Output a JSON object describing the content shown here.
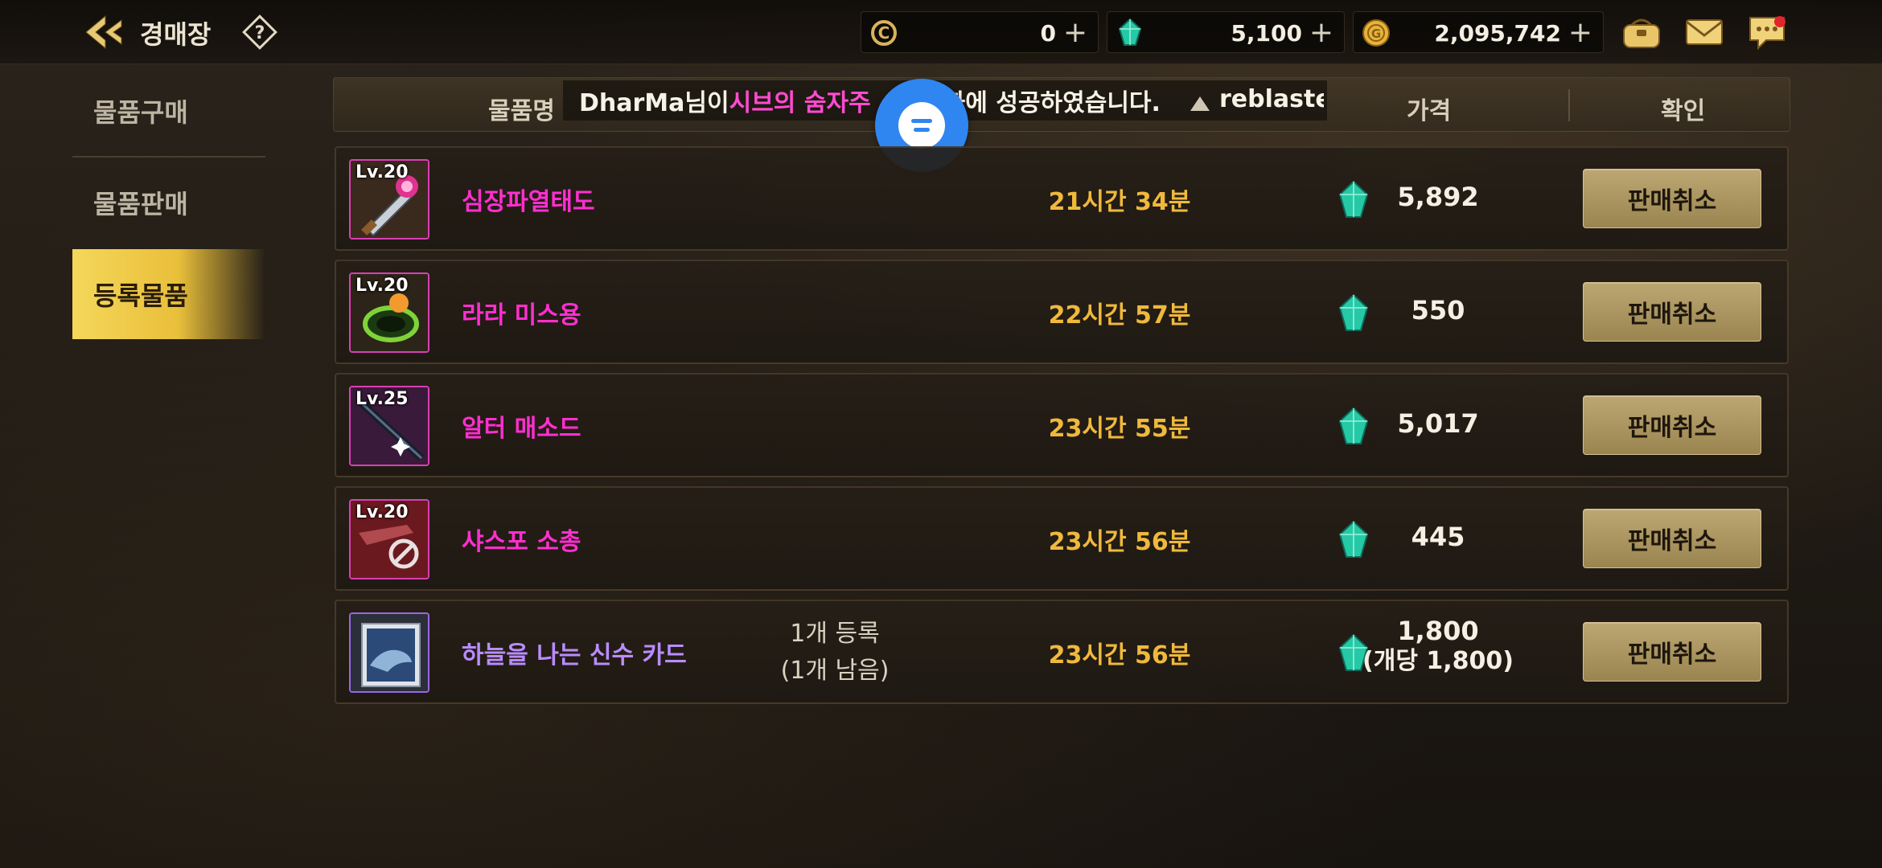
{
  "header": {
    "title": "경매장",
    "currencies": [
      {
        "icon": "c-coin-icon",
        "value": "0"
      },
      {
        "icon": "gem-icon",
        "value": "5,100"
      },
      {
        "icon": "gold-coin-icon",
        "value": "2,095,742"
      }
    ],
    "plus": "+"
  },
  "sidebar": {
    "items": [
      {
        "label": "물품구매"
      },
      {
        "label": "물품판매"
      },
      {
        "label": "등록물품"
      }
    ]
  },
  "table": {
    "headers": {
      "name": "물품명",
      "price": "가격",
      "confirm": "확인"
    },
    "toast": {
      "prefix": "DharMa님이 ",
      "highlight": "시브의 숨자",
      "middle": " 주",
      "suffix": "화에 성공하였습니다.",
      "tail": "reblaster"
    },
    "rows": [
      {
        "level": "Lv.20",
        "name": "심장파열태도",
        "quantity": "",
        "quantity_note": "",
        "time": "21시간 34분",
        "price": "5,892",
        "price_note": "",
        "button": "판매취소",
        "rarity": "magenta"
      },
      {
        "level": "Lv.20",
        "name": "라라 미스용",
        "quantity": "",
        "quantity_note": "",
        "time": "22시간 57분",
        "price": "550",
        "price_note": "",
        "button": "판매취소",
        "rarity": "magenta"
      },
      {
        "level": "Lv.25",
        "name": "알터 매소드",
        "quantity": "",
        "quantity_note": "",
        "time": "23시간 55분",
        "price": "5,017",
        "price_note": "",
        "button": "판매취소",
        "rarity": "magenta"
      },
      {
        "level": "Lv.20",
        "name": "샤스포 소총",
        "quantity": "",
        "quantity_note": "",
        "time": "23시간 56분",
        "price": "445",
        "price_note": "",
        "button": "판매취소",
        "rarity": "magenta"
      },
      {
        "level": "",
        "name": "하늘을 나는 신수 카드",
        "quantity": "1개 등록",
        "quantity_note": "(1개 남음)",
        "time": "23시간 56분",
        "price": "1,800",
        "price_note": "(개당 1,800)",
        "button": "판매취소",
        "rarity": "purple"
      }
    ]
  },
  "colors": {
    "accent_gold": "#f0b93c",
    "rarity_magenta": "#ff2fd0",
    "rarity_purple": "#b98cff",
    "chat_blue": "#2f86f0"
  }
}
